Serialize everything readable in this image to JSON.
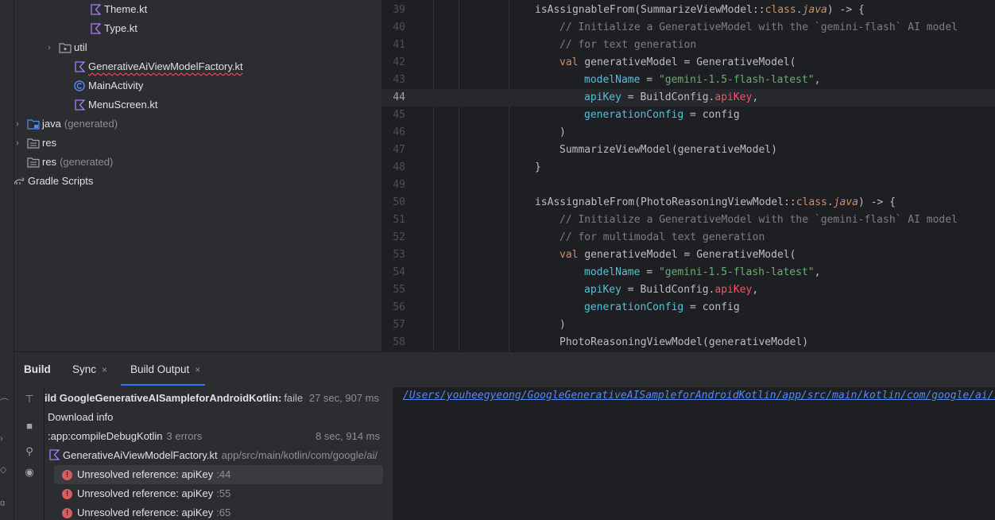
{
  "project_tree": {
    "items": [
      {
        "label": "Theme.kt",
        "icon": "kotlin-file-icon",
        "has_chevron": false
      },
      {
        "label": "Type.kt",
        "icon": "kotlin-file-icon",
        "has_chevron": false
      },
      {
        "label": "util",
        "icon": "package-folder-icon",
        "has_chevron": true
      },
      {
        "label": "GenerativeAiViewModelFactory.kt",
        "icon": "kotlin-file-icon",
        "has_chevron": false,
        "has_error": true
      },
      {
        "label": "MainActivity",
        "icon": "activity-class-icon",
        "has_chevron": false
      },
      {
        "label": "MenuScreen.kt",
        "icon": "kotlin-file-icon",
        "has_chevron": false
      },
      {
        "label": "java",
        "suffix": "(generated)",
        "icon": "generated-folder-icon",
        "has_chevron": true
      },
      {
        "label": "res",
        "icon": "resources-folder-icon",
        "has_chevron": true
      },
      {
        "label": "res",
        "suffix": "(generated)",
        "icon": "resources-folder-icon",
        "has_chevron": false
      },
      {
        "label": "Gradle Scripts",
        "icon": "gradle-icon",
        "has_chevron": true
      }
    ]
  },
  "editor": {
    "current_line": 44,
    "lines": [
      {
        "num": "39",
        "tokens": [
          [
            "plain",
            "isAssignableFrom(SummarizeViewModel::"
          ],
          [
            "kw",
            "class"
          ],
          [
            "plain",
            "."
          ],
          [
            "it",
            "java"
          ],
          [
            "plain",
            ") -> {"
          ]
        ]
      },
      {
        "num": "40",
        "tokens": [
          [
            "cmt",
            "// Initialize a GenerativeModel with the `gemini-flash` AI model"
          ]
        ]
      },
      {
        "num": "41",
        "tokens": [
          [
            "cmt",
            "// for text generation"
          ]
        ]
      },
      {
        "num": "42",
        "tokens": [
          [
            "kw",
            "val "
          ],
          [
            "plain",
            "generativeModel = GenerativeModel("
          ]
        ]
      },
      {
        "num": "43",
        "tokens": [
          [
            "named",
            "modelName"
          ],
          [
            "plain",
            " = "
          ],
          [
            "str",
            "\"gemini-1.5-flash-latest\""
          ],
          [
            "plain",
            ","
          ]
        ]
      },
      {
        "num": "44",
        "tokens": [
          [
            "named",
            "apiKey"
          ],
          [
            "plain",
            " = BuildConfig."
          ],
          [
            "err",
            "apiKey"
          ],
          [
            "plain",
            ","
          ]
        ]
      },
      {
        "num": "45",
        "tokens": [
          [
            "named",
            "generationConfig"
          ],
          [
            "plain",
            " = config"
          ]
        ]
      },
      {
        "num": "46",
        "tokens": [
          [
            "plain",
            ")"
          ]
        ]
      },
      {
        "num": "47",
        "tokens": [
          [
            "plain",
            "SummarizeViewModel(generativeModel)"
          ]
        ]
      },
      {
        "num": "48",
        "tokens": [
          [
            "plain",
            "}"
          ]
        ]
      },
      {
        "num": "49",
        "tokens": []
      },
      {
        "num": "50",
        "tokens": [
          [
            "plain",
            "isAssignableFrom(PhotoReasoningViewModel::"
          ],
          [
            "kw",
            "class"
          ],
          [
            "plain",
            "."
          ],
          [
            "it",
            "java"
          ],
          [
            "plain",
            ") -> {"
          ]
        ]
      },
      {
        "num": "51",
        "tokens": [
          [
            "cmt",
            "// Initialize a GenerativeModel with the `gemini-flash` AI model"
          ]
        ]
      },
      {
        "num": "52",
        "tokens": [
          [
            "cmt",
            "// for multimodal text generation"
          ]
        ]
      },
      {
        "num": "53",
        "tokens": [
          [
            "kw",
            "val "
          ],
          [
            "plain",
            "generativeModel = GenerativeModel("
          ]
        ]
      },
      {
        "num": "54",
        "tokens": [
          [
            "named",
            "modelName"
          ],
          [
            "plain",
            " = "
          ],
          [
            "str",
            "\"gemini-1.5-flash-latest\""
          ],
          [
            "plain",
            ","
          ]
        ]
      },
      {
        "num": "55",
        "tokens": [
          [
            "named",
            "apiKey"
          ],
          [
            "plain",
            " = BuildConfig."
          ],
          [
            "err",
            "apiKey"
          ],
          [
            "plain",
            ","
          ]
        ]
      },
      {
        "num": "56",
        "tokens": [
          [
            "named",
            "generationConfig"
          ],
          [
            "plain",
            " = config"
          ]
        ]
      },
      {
        "num": "57",
        "tokens": [
          [
            "plain",
            ")"
          ]
        ]
      },
      {
        "num": "58",
        "tokens": [
          [
            "plain",
            "PhotoReasoningViewModel(generativeModel)"
          ]
        ]
      }
    ]
  },
  "build": {
    "tabs": {
      "build": "Build",
      "sync": "Sync",
      "build_output": "Build Output",
      "close_glyph": "×"
    },
    "tree": {
      "root_label": "ild GoogleGenerativeAISampleforAndroidKotlin:",
      "root_status": "faile",
      "root_time": "27 sec, 907 ms",
      "download_info": "Download info",
      "task_label": ":app:compileDebugKotlin",
      "task_errors": "3 errors",
      "task_time": "8 sec, 914 ms",
      "file_label": "GenerativeAiViewModelFactory.kt",
      "file_path": "app/src/main/kotlin/com/google/ai/",
      "errors": [
        {
          "message": "Unresolved reference: apiKey",
          "line": ":44"
        },
        {
          "message": "Unresolved reference: apiKey",
          "line": ":55"
        },
        {
          "message": "Unresolved reference: apiKey",
          "line": ":65"
        }
      ]
    },
    "console_link": "/Users/youheegyeong/GoogleGenerativeAISampleforAndroidKotlin/app/src/main/kotlin/com/google/ai/sample/GenerativeAiViewModelFactory.kt"
  },
  "colors": {
    "accent": "#3574f0",
    "error": "#f75464",
    "link": "#548af7"
  }
}
